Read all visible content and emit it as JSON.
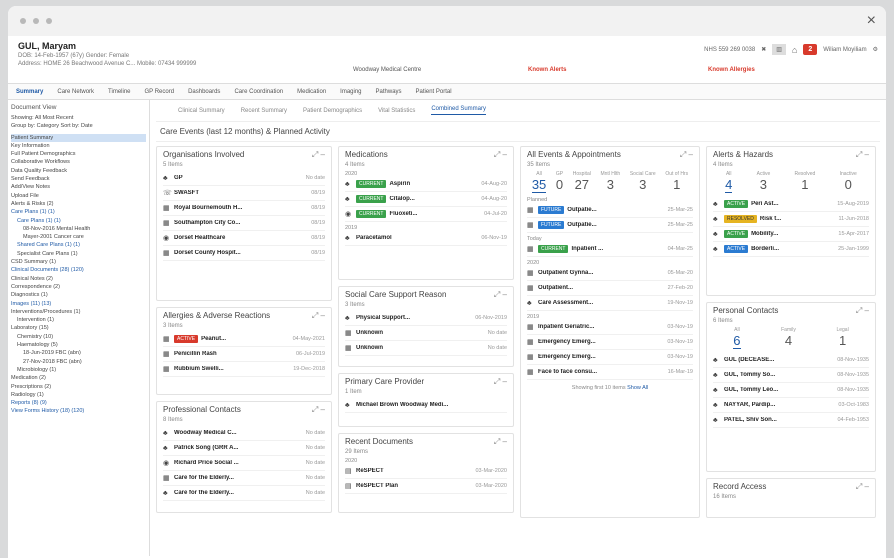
{
  "window": {
    "close_icon": "×"
  },
  "patient": {
    "name": "GUL, Maryam",
    "sub1": "DOB: 14-Feb-1957 (67y)   Gender: Female",
    "sub2": "Address: HOME 26 Beachwood Avenue C...   Mobile: 07434 999999",
    "practice": "Woodway Medical Centre",
    "alerts": "Known Alerts",
    "allergies": "Known Allergies",
    "nhs": "NHS 559 269 0038",
    "badge": "2",
    "user": "Wiliam Moyiliam"
  },
  "tabs": [
    "Summary",
    "Care Network",
    "Timeline",
    "GP Record",
    "Dashboards",
    "Care Coordination",
    "Medication",
    "Imaging",
    "Pathways",
    "Patient Portal"
  ],
  "sidebar": {
    "title": "Document View",
    "sub1": "Showing: All  Most Recent",
    "sub2": "Group by: Category  Sort by: Date",
    "items": [
      {
        "t": "Patient Summary",
        "sel": true,
        "indent": 0
      },
      {
        "t": "Key Information",
        "indent": 0
      },
      {
        "t": "Full Patient Demographics",
        "indent": 0
      },
      {
        "t": "Collaborative Workflows",
        "indent": 0
      },
      {
        "t": "Data Quality Feedback",
        "indent": 0
      },
      {
        "t": "Send Feedback",
        "indent": 0
      },
      {
        "t": "Add/View Notes",
        "indent": 0
      },
      {
        "t": "Upload File",
        "indent": 0
      },
      {
        "t": "Alerts & Risks (2)",
        "indent": 0
      },
      {
        "t": "Care Plans (1) (1)",
        "indent": 0,
        "blue": true
      },
      {
        "t": "Care Plans (1) (1)",
        "indent": 1,
        "blue": true
      },
      {
        "t": "08-Nov-2016  Mental Health",
        "indent": 2
      },
      {
        "t": "Mayer-2001  Cancer care",
        "indent": 2
      },
      {
        "t": "Shared Care Plans (1) (1)",
        "indent": 1,
        "blue": true
      },
      {
        "t": "Specialist Care Plans (1)",
        "indent": 1
      },
      {
        "t": "CSD Summary (1)",
        "indent": 0
      },
      {
        "t": "Clinical Documents (28) (120)",
        "indent": 0,
        "blue": true
      },
      {
        "t": "Clinical Notes (2)",
        "indent": 0
      },
      {
        "t": "Correspondence (2)",
        "indent": 0
      },
      {
        "t": "Diagnostics (1)",
        "indent": 0
      },
      {
        "t": "Images (11) (13)",
        "indent": 0,
        "blue": true
      },
      {
        "t": "Interventions/Procedures (1)",
        "indent": 0
      },
      {
        "t": "Intervention (1)",
        "indent": 1
      },
      {
        "t": "Laboratory (15)",
        "indent": 0
      },
      {
        "t": "Chemistry (10)",
        "indent": 1
      },
      {
        "t": "Haematology (5)",
        "indent": 1
      },
      {
        "t": "18-Jun-2019  FBC (abn)",
        "indent": 2
      },
      {
        "t": "27-Nov-2018  FBC (abn)",
        "indent": 2
      },
      {
        "t": "Microbiology (1)",
        "indent": 1
      },
      {
        "t": "Medication (2)",
        "indent": 0
      },
      {
        "t": "Prescriptions (2)",
        "indent": 0
      },
      {
        "t": "Radiology (1)",
        "indent": 0
      },
      {
        "t": "Reports (8) (9)",
        "indent": 0,
        "blue": true
      },
      {
        "t": "View Forms History (18) (120)",
        "indent": 0,
        "blue": true
      }
    ]
  },
  "subtabs": [
    "Clinical Summary",
    "Recent Summary",
    "Patient Demographics",
    "Vital Statistics",
    "Combined Summary"
  ],
  "section_title": "Care Events (last 12 months) & Planned Activity",
  "cards": {
    "orgs": {
      "title": "Organisations Involved",
      "count": "5 Items",
      "rows": [
        {
          "i": "♣",
          "l": "GP",
          "d": "No date"
        },
        {
          "i": "☏",
          "l": "SWASFT",
          "d": "08/19"
        },
        {
          "i": "▦",
          "l": "Royal Bournemouth H...",
          "d": "08/19"
        },
        {
          "i": "▦",
          "l": "Southampton City Co...",
          "d": "08/19"
        },
        {
          "i": "◉",
          "l": "Dorset Healthcare",
          "d": "08/19"
        },
        {
          "i": "▦",
          "l": "Dorset County Hospit...",
          "d": "08/19"
        }
      ]
    },
    "allergies": {
      "title": "Allergies & Adverse Reactions",
      "count": "3 Items",
      "rows": [
        {
          "i": "▦",
          "tag": "ACTIVE",
          "tc": "red",
          "l": "Peanut...",
          "d": "04-May-2021"
        },
        {
          "i": "▦",
          "l": "Penicillin  Rash",
          "d": "06-Jul-2019"
        },
        {
          "i": "▦",
          "l": "Rubbium  Swelli...",
          "d": "19-Dec-2018"
        }
      ]
    },
    "contacts": {
      "title": "Professional Contacts",
      "count": "8 Items",
      "rows": [
        {
          "i": "♣",
          "l": "Woodway Medical C...",
          "d": "No date"
        },
        {
          "i": "♣",
          "l": "Patrick Song (GRR A...",
          "d": "No date"
        },
        {
          "i": "◉",
          "l": "Richard Price  Social ...",
          "d": "No date"
        },
        {
          "i": "▦",
          "l": "Care for the Elderly...",
          "d": "No date"
        },
        {
          "i": "♣",
          "l": "Care for the Elderly...",
          "d": "No date"
        }
      ]
    },
    "meds": {
      "title": "Medications",
      "count": "4 Items",
      "hdr1": "2020",
      "hdr2": "2019",
      "rows": [
        {
          "i": "♣",
          "tag": "CURRENT",
          "tc": "green",
          "l": "Aspirin",
          "d": "04-Aug-20"
        },
        {
          "i": "♣",
          "tag": "CURRENT",
          "tc": "green",
          "l": "Citalop...",
          "d": "04-Aug-20"
        },
        {
          "i": "◉",
          "tag": "CURRENT",
          "tc": "green",
          "l": "Fluoxeti...",
          "d": "04-Jul-20"
        }
      ],
      "rows2": [
        {
          "i": "♣",
          "l": "Paracetamol",
          "d": "06-Nov-19"
        }
      ]
    },
    "social": {
      "title": "Social Care Support Reason",
      "count": "3 Items",
      "rows": [
        {
          "i": "♣",
          "l": "Physical Support...",
          "d": "06-Nov-2019"
        },
        {
          "i": "▦",
          "l": "Unknown",
          "d": "No date"
        },
        {
          "i": "▦",
          "l": "Unknown",
          "d": "No date"
        }
      ]
    },
    "primary": {
      "title": "Primary Care Provider",
      "count": "1 Item",
      "rows": [
        {
          "i": "♣",
          "l": "Michael Brown  Woodway Medi...",
          "d": ""
        }
      ]
    },
    "docs": {
      "title": "Recent Documents",
      "count": "29 Items",
      "hdr": "2020",
      "rows": [
        {
          "i": "▤",
          "l": "ReSPECT",
          "d": "03-Mar-2020"
        },
        {
          "i": "▤",
          "l": "ReSPECT Plan",
          "d": "03-Mar-2020"
        }
      ]
    },
    "events": {
      "title": "All Events & Appointments",
      "count": "35 Items",
      "stats": [
        {
          "n": "35",
          "l": "All",
          "active": true
        },
        {
          "n": "0",
          "l": "GP"
        },
        {
          "n": "27",
          "l": "Hospital"
        },
        {
          "n": "3",
          "l": "Mntl Hlth"
        },
        {
          "n": "3",
          "l": "Social Care"
        },
        {
          "n": "1",
          "l": "Out of Hrs"
        }
      ],
      "hdr1": "Planned",
      "hdr2": "Today",
      "hdr3": "2020",
      "hdr4": "2019",
      "rows1": [
        {
          "i": "▦",
          "tag": "FUTURE",
          "tc": "blue",
          "l": "Outpatie...",
          "d": "25-Mar-25"
        },
        {
          "i": "▦",
          "tag": "FUTURE",
          "tc": "blue",
          "l": "Outpatie...",
          "d": "25-Mar-25"
        }
      ],
      "rows2": [
        {
          "i": "▦",
          "tag": "CURRENT",
          "tc": "green",
          "l": "Inpatient ...",
          "d": "04-Mar-25"
        }
      ],
      "rows3": [
        {
          "i": "▦",
          "l": "Outpatient  Gynna...",
          "d": "05-Mar-20"
        },
        {
          "i": "▦",
          "l": "Outpatient...",
          "d": "27-Feb-20"
        },
        {
          "i": "♣",
          "l": "Care Assessment...",
          "d": "19-Nov-19"
        }
      ],
      "rows4": [
        {
          "i": "▦",
          "l": "Inpatient  Geriatric...",
          "d": "03-Nov-19"
        },
        {
          "i": "▦",
          "l": "Emergency  Emerg...",
          "d": "03-Nov-19"
        },
        {
          "i": "▦",
          "l": "Emergency  Emerg...",
          "d": "03-Nov-19"
        },
        {
          "i": "▦",
          "l": "Face to face consu...",
          "d": "16-Mar-19"
        }
      ],
      "foot": "Showing first 10 items",
      "foot_link": "Show All"
    },
    "alerts": {
      "title": "Alerts & Hazards",
      "count": "4 Items",
      "stats": [
        {
          "n": "4",
          "l": "All",
          "active": true
        },
        {
          "n": "3",
          "l": "Active"
        },
        {
          "n": "1",
          "l": "Resolved"
        },
        {
          "n": "0",
          "l": "Inactive"
        }
      ],
      "rows": [
        {
          "i": "♣",
          "tag": "ACTIVE",
          "tc": "green",
          "l": "Peri Ast...",
          "d": "15-Aug-2019"
        },
        {
          "i": "♣",
          "tag": "RESOLVED",
          "tc": "yellow",
          "l": "Risk t...",
          "d": "11-Jun-2018"
        },
        {
          "i": "♣",
          "tag": "ACTIVE",
          "tc": "green",
          "l": "Mobility...",
          "d": "15-Apr-2017"
        },
        {
          "i": "♣",
          "tag": "ACTIVE",
          "tc": "blue",
          "l": "Borderli...",
          "d": "25-Jan-1999"
        }
      ]
    },
    "personal": {
      "title": "Personal Contacts",
      "count": "6 Items",
      "stats": [
        {
          "n": "6",
          "l": "All",
          "active": true
        },
        {
          "n": "4",
          "l": "Family"
        },
        {
          "n": "1",
          "l": "Legal"
        }
      ],
      "rows": [
        {
          "i": "♣",
          "l": "GUL (DECEASE...",
          "d": "08-Nov-1935"
        },
        {
          "i": "♣",
          "l": "GUL, Tommy  So...",
          "d": "08-Nov-1935"
        },
        {
          "i": "♣",
          "l": "GUL, Tommy  Leo...",
          "d": "08-Nov-1935"
        },
        {
          "i": "♣",
          "l": "NAYYAR, Pardip...",
          "d": "03-Oct-1983"
        },
        {
          "i": "♣",
          "l": "PATEL, Shiv  Son...",
          "d": "04-Feb-1953"
        }
      ]
    },
    "record": {
      "title": "Record Access",
      "count": "16 Items"
    }
  }
}
